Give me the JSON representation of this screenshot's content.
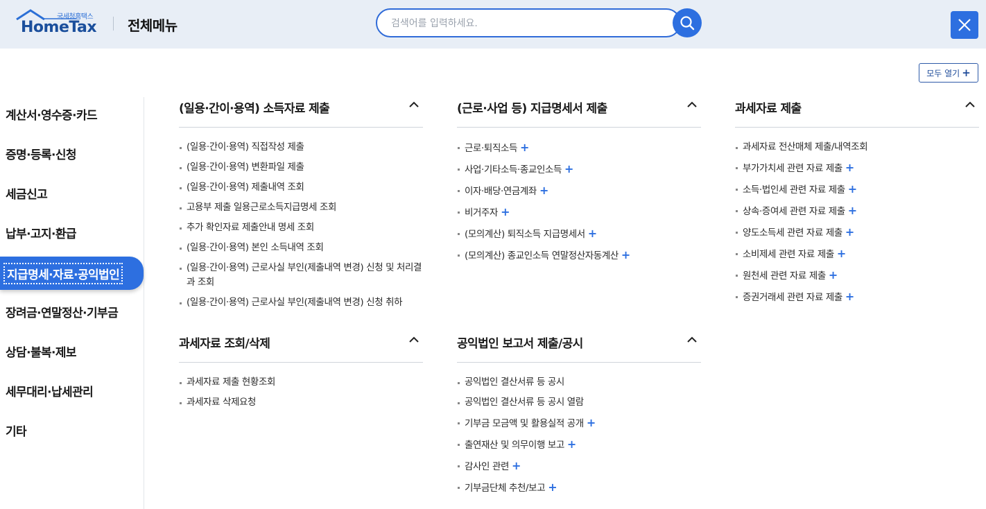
{
  "header": {
    "logo_small": "국세청홈택스",
    "logo_main": "HomeTax",
    "title": "전체메뉴",
    "search_placeholder": "검색어를 입력하세요.",
    "search_value": ""
  },
  "expand_all_label": "모두 열기",
  "plus_symbol": "+",
  "sidebar": {
    "items": [
      {
        "label": "계산서·영수증·카드"
      },
      {
        "label": "증명·등록·신청"
      },
      {
        "label": "세금신고"
      },
      {
        "label": "납부·고지·환급"
      },
      {
        "label": "지급명세·자료·공익법인"
      },
      {
        "label": "장려금·연말정산·기부금"
      },
      {
        "label": "상담·불복·제보"
      },
      {
        "label": "세무대리·납세관리"
      },
      {
        "label": "기타"
      }
    ],
    "active_index": 4
  },
  "sections": [
    {
      "title": "(일용·간이·용역) 소득자료 제출",
      "items": [
        "(일용·간이·용역) 직접작성 제출",
        "(일용·간이·용역) 변환파일 제출",
        "(일용·간이·용역) 제출내역 조회",
        "고용부 제출 일용근로소득지급명세 조회",
        "추가 확인자료 제출안내 명세 조회",
        "(일용·간이·용역) 본인 소득내역 조회",
        "(일용·간이·용역) 근로사실 부인(제출내역 변경) 신청 및 처리결과 조회",
        "(일용·간이·용역) 근로사실 부인(제출내역 변경) 신청 취하"
      ]
    },
    {
      "title": "(근로·사업 등) 지급명세서 제출",
      "items": [
        "근로·퇴직소득",
        "사업·기타소득·종교인소득",
        "이자·배당·연금계좌",
        "비거주자",
        "(모의계산) 퇴직소득 지급명세서",
        "(모의계산) 종교인소득 연말정산자동계산"
      ]
    },
    {
      "title": "과세자료 제출",
      "items": [
        "과세자료 전산매체 제출/내역조회",
        "부가가치세 관련 자료 제출",
        "소득·법인세 관련 자료 제출",
        "상속·증여세 관련 자료 제출",
        "양도소득세 관련 자료 제출",
        "소비제세 관련 자료 제출",
        "원천세 관련 자료 제출",
        "증권거래세 관련 자료 제출"
      ]
    },
    {
      "title": "과세자료 조회/삭제",
      "items": [
        "과세자료 제출 현황조회",
        "과세자료 삭제요청"
      ]
    },
    {
      "title": "공익법인 보고서 제출/공시",
      "items": [
        "공익법인 결산서류 등 공시",
        "공익법인 결산서류 등 공시 열람",
        "기부금 모금액 및 활용실적 공개",
        "출연재산 및 의무이행 보고",
        "감사인 관련",
        "기부금단체 추천/보고"
      ]
    }
  ],
  "colors": {
    "accent": "#2d6fe0",
    "header_bg": "#e8eef6",
    "brand_dark": "#1b4f9c"
  }
}
